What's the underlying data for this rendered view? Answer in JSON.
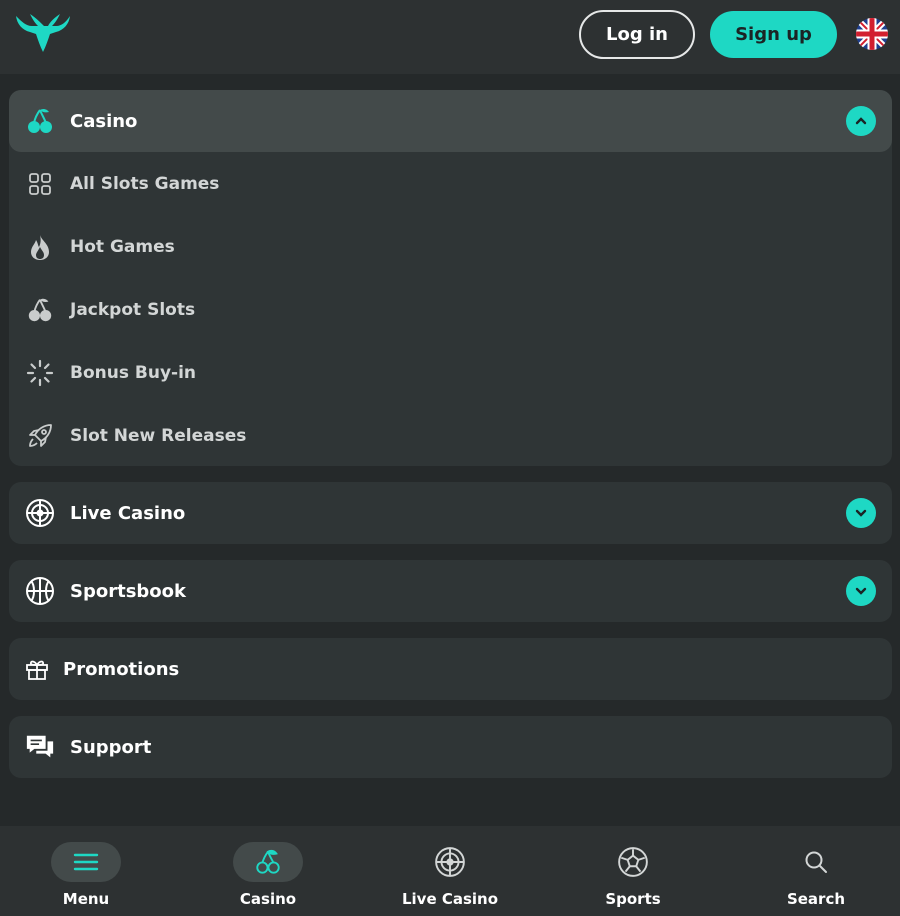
{
  "header": {
    "logo_icon": "stag-logo-icon",
    "login_label": "Log in",
    "signup_label": "Sign up",
    "language_icon": "uk-flag-icon",
    "accent_color": "#1ed8c4"
  },
  "menu": {
    "casino": {
      "label": "Casino",
      "icon": "cherries-icon",
      "expanded": true,
      "items": [
        {
          "label": "All Slots Games",
          "icon": "grid-icon"
        },
        {
          "label": "Hot Games",
          "icon": "flame-icon"
        },
        {
          "label": "Jackpot Slots",
          "icon": "cherries-icon"
        },
        {
          "label": "Bonus Buy-in",
          "icon": "spinner-icon"
        },
        {
          "label": "Slot New Releases",
          "icon": "rocket-icon"
        }
      ]
    },
    "live_casino": {
      "label": "Live Casino",
      "icon": "roulette-icon",
      "expanded": false
    },
    "sportsbook": {
      "label": "Sportsbook",
      "icon": "basketball-icon",
      "expanded": false
    },
    "promotions": {
      "label": "Promotions",
      "icon": "gift-icon"
    },
    "support": {
      "label": "Support",
      "icon": "chat-icon"
    }
  },
  "bottom_nav": {
    "items": [
      {
        "label": "Menu",
        "icon": "hamburger-icon",
        "active": true
      },
      {
        "label": "Casino",
        "icon": "cherries-icon",
        "active": true
      },
      {
        "label": "Live Casino",
        "icon": "roulette-icon",
        "active": false
      },
      {
        "label": "Sports",
        "icon": "soccer-ball-icon",
        "active": false
      },
      {
        "label": "Search",
        "icon": "search-icon",
        "active": false
      }
    ]
  }
}
